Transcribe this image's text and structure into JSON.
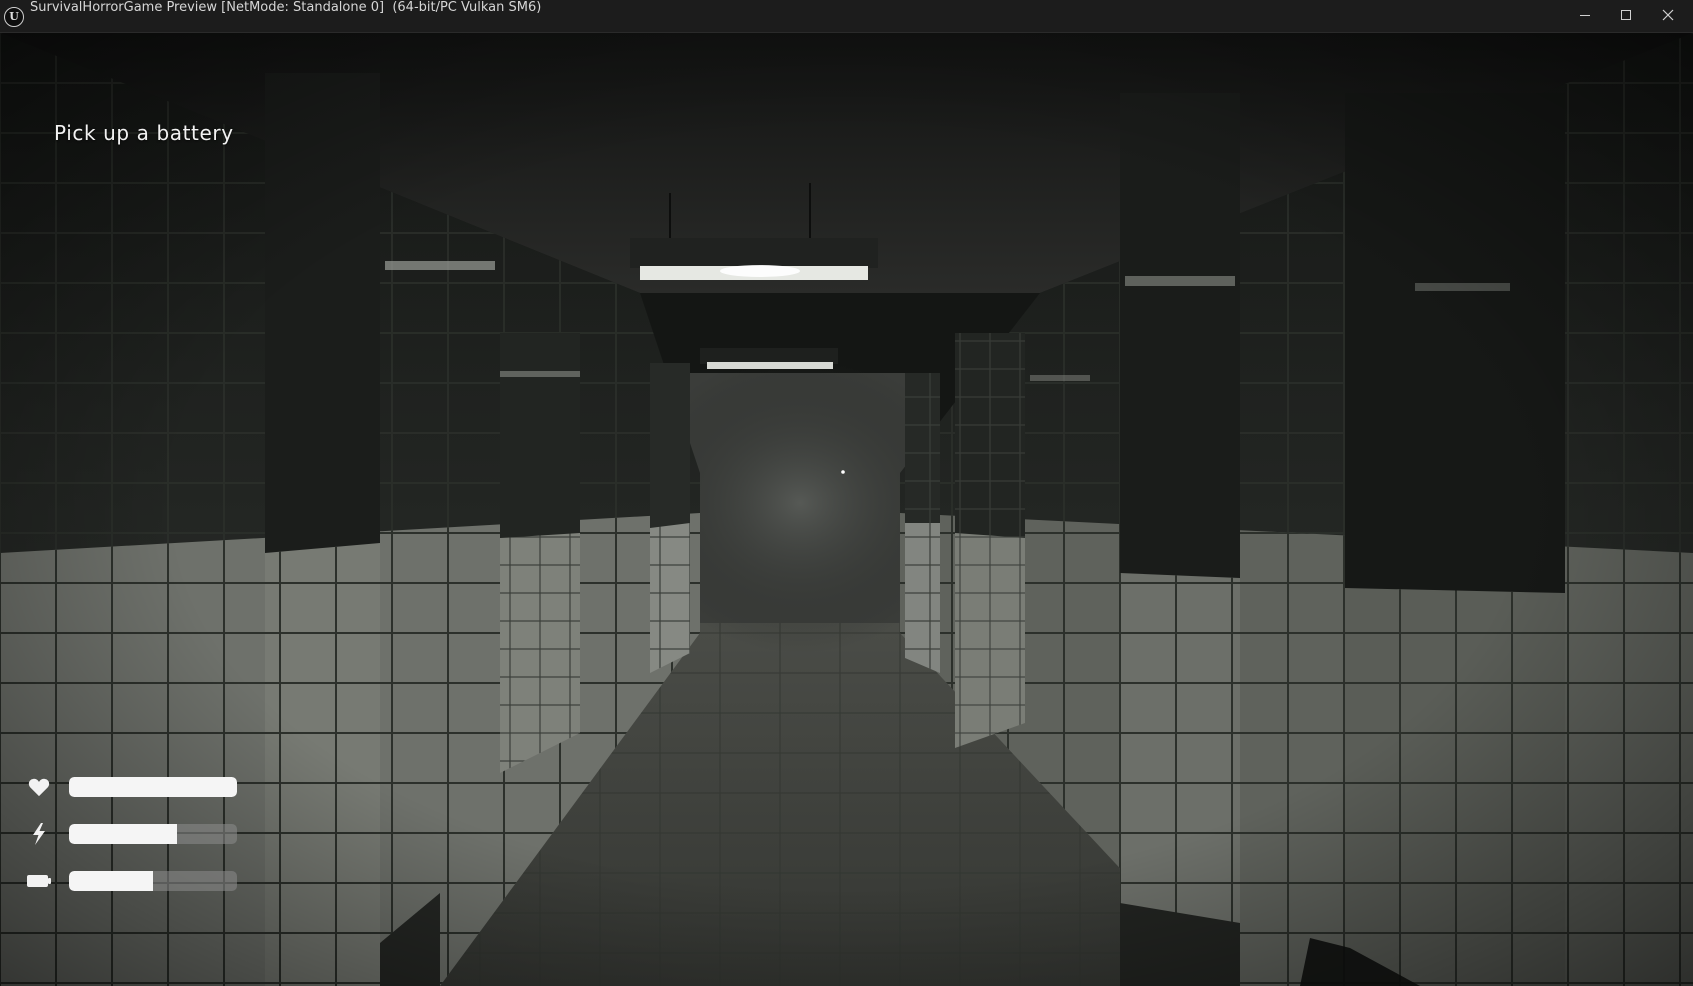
{
  "window": {
    "title": "SurvivalHorrorGame Preview [NetMode: Standalone 0]  (64-bit/PC Vulkan SM6)",
    "app_icon": "unreal-engine-logo-icon",
    "controls": [
      "minimize-icon",
      "maximize-icon",
      "close-icon"
    ]
  },
  "hud": {
    "objective": "Pick up a battery",
    "stats": [
      {
        "id": "health",
        "icon": "heart-icon",
        "level": 1.0
      },
      {
        "id": "stamina",
        "icon": "lightning-icon",
        "level": 0.64
      },
      {
        "id": "battery",
        "icon": "battery-icon",
        "level": 0.5
      }
    ]
  },
  "colors": {
    "titlebar": "#1c1c1c",
    "title_text": "#d6d6d6",
    "bar_fill": "#f5f5f5",
    "bar_track": "#8c8c8c"
  }
}
